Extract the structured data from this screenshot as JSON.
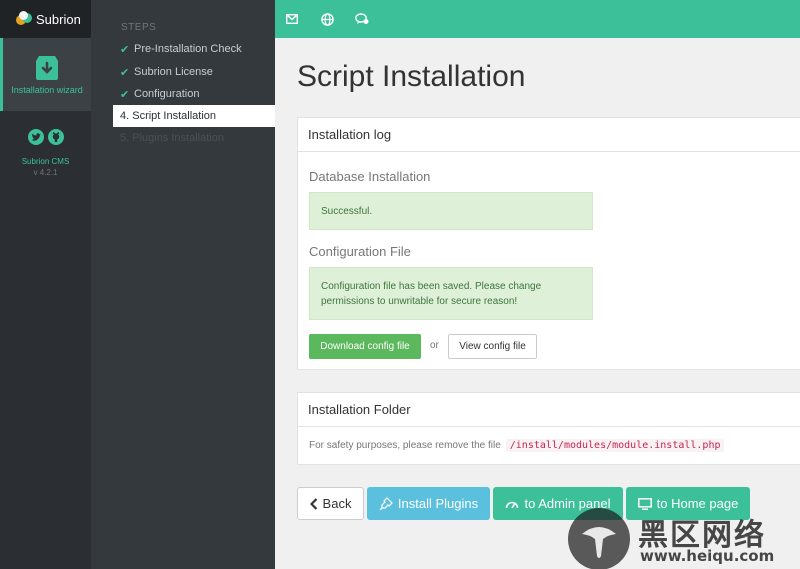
{
  "app": {
    "name": "Subrion"
  },
  "rail": {
    "wizard_label": "Installation wizard",
    "cms_label": "Subrion CMS",
    "version": "v 4.2.1",
    "social": [
      "twitter-icon",
      "github-icon"
    ]
  },
  "steps": {
    "title": "STEPS",
    "items": [
      {
        "label": "Pre-Installation Check",
        "state": "done"
      },
      {
        "label": "Subrion License",
        "state": "done"
      },
      {
        "label": "Configuration",
        "state": "done"
      },
      {
        "label": "4. Script Installation",
        "state": "active"
      },
      {
        "label": "5. Plugins Installation",
        "state": "disabled"
      }
    ]
  },
  "topbar": {
    "icons": [
      "mail-icon",
      "globe-icon",
      "chat-icon"
    ]
  },
  "main": {
    "title": "Script Installation",
    "log_panel": {
      "heading": "Installation log",
      "db_title": "Database Installation",
      "db_status": "Successful.",
      "config_title": "Configuration File",
      "config_status": "Configuration file has been saved. Please change permissions to unwritable for secure reason!",
      "download_label": "Download config file",
      "or_label": "or",
      "view_label": "View config file"
    },
    "folder_panel": {
      "heading": "Installation Folder",
      "text": "For safety purposes, please remove the file",
      "path": "/install/modules/module.install.php"
    },
    "actions": {
      "back": "Back",
      "install_plugins": "Install Plugins",
      "admin": "to Admin panel",
      "home": "to Home page"
    }
  },
  "watermark": {
    "text": "黑区网络",
    "url": "www.heiqu.com"
  },
  "colors": {
    "accent": "#3cc09a",
    "info": "#5bc0de",
    "success": "#5cb85c",
    "sidebar": "#2b2f33"
  }
}
